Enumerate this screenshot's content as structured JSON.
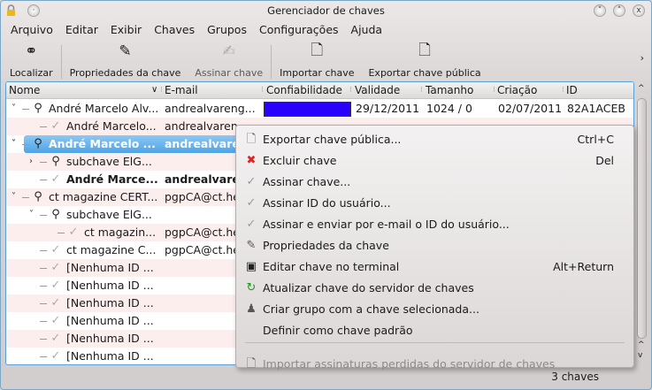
{
  "window": {
    "title": "Gerenciador de chaves"
  },
  "menubar": [
    "Arquivo",
    "Editar",
    "Exibir",
    "Chaves",
    "Grupos",
    "Configurações",
    "Ajuda"
  ],
  "toolbar": {
    "find": "Localizar",
    "properties": "Propriedades da chave",
    "sign": "Assinar chave",
    "import": "Importar chave",
    "export": "Exportar chave pública"
  },
  "columns": [
    "Nome",
    "E-mail",
    "Confiabilidade",
    "Validade",
    "Tamanho",
    "Criação",
    "ID"
  ],
  "rows": [
    {
      "name": "André Marcelo Alv...",
      "email": "andrealvareng...",
      "validity": "29/12/2011",
      "size": "1024 / 0",
      "created": "02/07/2011",
      "id": "82A1ACEB",
      "trust_color": "#2a00ff"
    },
    {
      "name": "André Marcelo...",
      "email": "andrealvaren..."
    },
    {
      "name": "André Marcelo ...",
      "email": "andrealvare"
    },
    {
      "name": "subchave ElG..."
    },
    {
      "name": "André Marce...",
      "email": "andrealvare"
    },
    {
      "name": "ct magazine CERT...",
      "email": "pgpCA@ct.he"
    },
    {
      "name": "subchave ElG..."
    },
    {
      "name": "ct magazin...",
      "email": "pgpCA@ct.he"
    },
    {
      "name": "ct magazine C...",
      "email": "pgpCA@ct.he"
    },
    {
      "name": "[Nenhuma ID ..."
    },
    {
      "name": "[Nenhuma ID ..."
    },
    {
      "name": "[Nenhuma ID ..."
    },
    {
      "name": "[Nenhuma ID ..."
    },
    {
      "name": "[Nenhuma ID ..."
    },
    {
      "name": "[Nenhuma ID ..."
    }
  ],
  "context_menu": [
    {
      "label": "Exportar chave pública...",
      "shortcut": "Ctrl+C",
      "icon": "export-icon"
    },
    {
      "label": "Excluir chave",
      "shortcut": "Del",
      "icon": "delete-icon"
    },
    {
      "label": "Assinar chave...",
      "icon": "sign-icon"
    },
    {
      "label": "Assinar ID do usuário...",
      "icon": "sign-icon"
    },
    {
      "label": "Assinar e enviar por e-mail o ID do usuário...",
      "icon": "sign-icon"
    },
    {
      "label": "Propriedades da chave",
      "icon": "properties-icon"
    },
    {
      "label": "Editar chave no terminal",
      "shortcut": "Alt+Return",
      "icon": "terminal-icon"
    },
    {
      "label": "Atualizar chave do servidor de chaves",
      "icon": "refresh-icon"
    },
    {
      "label": "Criar grupo com a chave selecionada...",
      "icon": "group-icon"
    },
    {
      "label": "Definir como chave padrão"
    },
    {
      "label": "Importar assinaturas perdidas do servidor de chaves",
      "icon": "import-icon",
      "disabled": true
    }
  ],
  "status": "3 chaves"
}
